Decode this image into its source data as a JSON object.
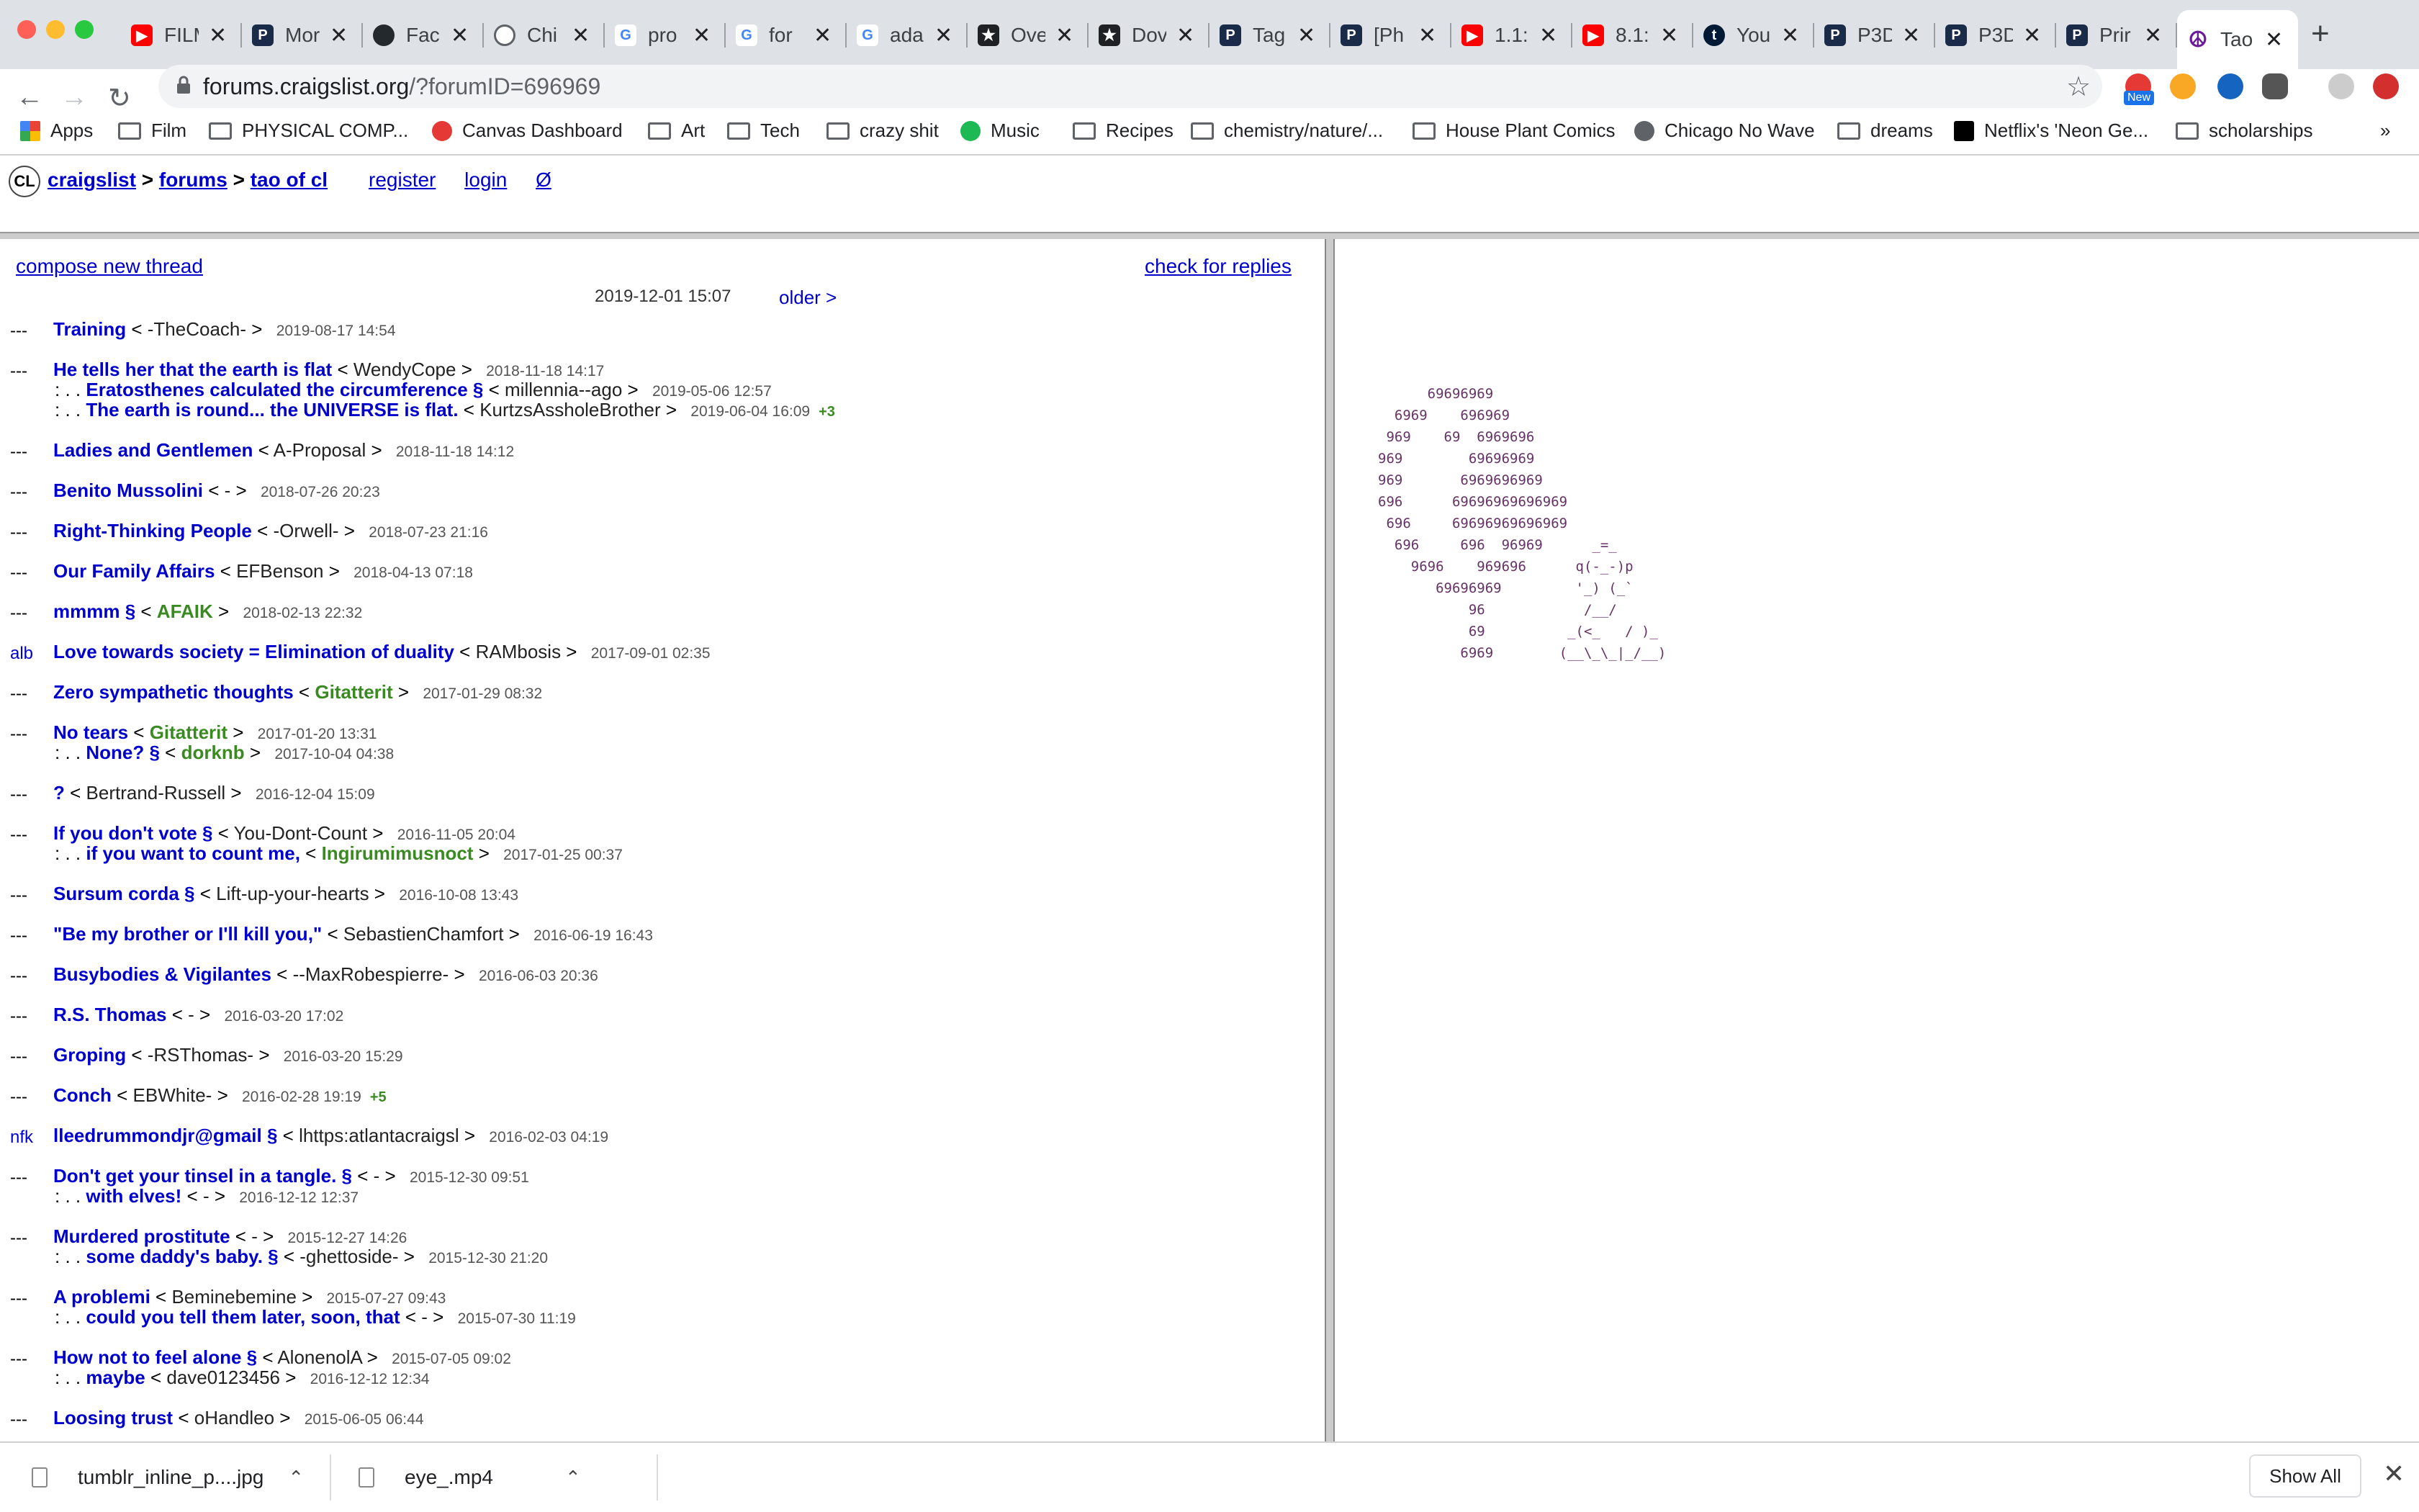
{
  "browser": {
    "tabs": [
      {
        "title": "FILM",
        "icon": "youtube-icon",
        "color": "#ff0000"
      },
      {
        "title": "Mor",
        "icon": "p-icon",
        "color": "#1a2b4a"
      },
      {
        "title": "Fac",
        "icon": "github-icon",
        "color": "#24292e"
      },
      {
        "title": "Chi",
        "icon": "globe-icon",
        "color": "#5f6368"
      },
      {
        "title": "pro",
        "icon": "google-icon",
        "color": "#4285f4"
      },
      {
        "title": "for",
        "icon": "google-icon",
        "color": "#4285f4"
      },
      {
        "title": "ada",
        "icon": "google-icon",
        "color": "#4285f4"
      },
      {
        "title": "Ove",
        "icon": "star-badge-icon",
        "color": "#202124"
      },
      {
        "title": "Dov",
        "icon": "star-badge-icon",
        "color": "#202124"
      },
      {
        "title": "Tag",
        "icon": "p-icon",
        "color": "#1a2b4a"
      },
      {
        "title": "[Ph",
        "icon": "p-icon",
        "color": "#1a2b4a"
      },
      {
        "title": "1.1:",
        "icon": "youtube-icon",
        "color": "#ff0000"
      },
      {
        "title": "8.1:",
        "icon": "youtube-icon",
        "color": "#ff0000"
      },
      {
        "title": "You",
        "icon": "tumblr-icon",
        "color": "#001935"
      },
      {
        "title": "P3D",
        "icon": "p-icon",
        "color": "#1a2b4a"
      },
      {
        "title": "P3D",
        "icon": "p-icon",
        "color": "#1a2b4a"
      },
      {
        "title": "Prir",
        "icon": "p-icon",
        "color": "#1a2b4a"
      },
      {
        "title": "Tao",
        "icon": "peace-icon",
        "color": "#6a1b9a",
        "active": true
      }
    ],
    "url_host": "forums.craigslist.org",
    "url_path": "/?forumID=696969",
    "extension_badge": "New",
    "bookmarks": [
      {
        "label": "Apps",
        "icon": "apps-grid-icon"
      },
      {
        "label": "Film",
        "icon": "folder-icon"
      },
      {
        "label": "PHYSICAL COMP...",
        "icon": "folder-icon"
      },
      {
        "label": "Canvas Dashboard",
        "icon": "canvas-icon"
      },
      {
        "label": "Art",
        "icon": "folder-icon"
      },
      {
        "label": "Tech",
        "icon": "folder-icon"
      },
      {
        "label": "crazy shit",
        "icon": "folder-icon"
      },
      {
        "label": "Music",
        "icon": "spotify-icon"
      },
      {
        "label": "Recipes",
        "icon": "folder-icon"
      },
      {
        "label": "chemistry/nature/...",
        "icon": "folder-icon"
      },
      {
        "label": "House Plant Comics",
        "icon": "folder-icon"
      },
      {
        "label": "Chicago No Wave",
        "icon": "globe-icon"
      },
      {
        "label": "dreams",
        "icon": "folder-icon"
      },
      {
        "label": "Netflix's 'Neon Ge...",
        "icon": "netflix-icon"
      },
      {
        "label": "scholarships",
        "icon": "folder-icon"
      }
    ],
    "more_bookmarks": "»"
  },
  "header": {
    "logo": "CL",
    "breadcrumb": [
      "craigslist",
      "forums",
      "tao of cl"
    ],
    "sep": ">",
    "links": [
      "register",
      "login",
      "Ø"
    ]
  },
  "forum": {
    "compose": "compose new thread",
    "check": "check for replies",
    "current_date": "2019-12-01 15:07",
    "older": "older >",
    "threads": [
      {
        "mark": "---",
        "posts": [
          {
            "subject": "Training",
            "author": "-TheCoach-",
            "date": "2019-08-17 14:54"
          }
        ]
      },
      {
        "mark": "---",
        "posts": [
          {
            "subject": "He tells her that the earth is flat",
            "author": "WendyCope",
            "date": "2018-11-18 14:17"
          },
          {
            "subject": "Eratosthenes calculated the circumference §",
            "author": "millennia--ago",
            "date": "2019-05-06 12:57",
            "indent": ": . ."
          },
          {
            "subject": "The earth is round... the UNIVERSE is flat.",
            "author": "KurtzsAssholeBrother",
            "date": "2019-06-04 16:09",
            "indent": ": . .",
            "more": "+3"
          }
        ]
      },
      {
        "mark": "---",
        "posts": [
          {
            "subject": "Ladies and Gentlemen",
            "author": "A-Proposal",
            "date": "2018-11-18 14:12"
          }
        ]
      },
      {
        "mark": "---",
        "posts": [
          {
            "subject": "Benito Mussolini",
            "author": "-",
            "date": "2018-07-26 20:23"
          }
        ]
      },
      {
        "mark": "---",
        "posts": [
          {
            "subject": "Right-Thinking People",
            "author": "-Orwell-",
            "date": "2018-07-23 21:16"
          }
        ]
      },
      {
        "mark": "---",
        "posts": [
          {
            "subject": "Our Family Affairs",
            "author": "EFBenson",
            "date": "2018-04-13 07:18"
          }
        ]
      },
      {
        "mark": "---",
        "posts": [
          {
            "subject": "mmmm §",
            "author": "AFAIK",
            "author_green": true,
            "date": "2018-02-13 22:32"
          }
        ]
      },
      {
        "mark": "alb",
        "mark_tag": true,
        "posts": [
          {
            "subject": "Love towards society = Elimination of duality",
            "author": "RAMbosis",
            "date": "2017-09-01 02:35"
          }
        ]
      },
      {
        "mark": "---",
        "posts": [
          {
            "subject": "Zero sympathetic thoughts",
            "author": "Gitatterit",
            "author_green": true,
            "date": "2017-01-29 08:32"
          }
        ]
      },
      {
        "mark": "---",
        "posts": [
          {
            "subject": "No tears",
            "author": "Gitatterit",
            "author_green": true,
            "date": "2017-01-20 13:31"
          },
          {
            "subject": "None? §",
            "author": "dorknb",
            "author_green": true,
            "date": "2017-10-04 04:38",
            "indent": ": . ."
          }
        ]
      },
      {
        "mark": "---",
        "posts": [
          {
            "subject": "?",
            "author": "Bertrand-Russell",
            "date": "2016-12-04 15:09"
          }
        ]
      },
      {
        "mark": "---",
        "posts": [
          {
            "subject": "If you don't vote §",
            "author": "You-Dont-Count",
            "date": "2016-11-05 20:04"
          },
          {
            "subject": "if you want to count me,",
            "author": "Ingirumimusnoct",
            "author_green": true,
            "date": "2017-01-25 00:37",
            "indent": ": . ."
          }
        ]
      },
      {
        "mark": "---",
        "posts": [
          {
            "subject": "Sursum corda §",
            "author": "Lift-up-your-hearts",
            "date": "2016-10-08 13:43"
          }
        ]
      },
      {
        "mark": "---",
        "posts": [
          {
            "subject": "\"Be my brother or I'll kill you,\"",
            "author": "SebastienChamfort",
            "date": "2016-06-19 16:43"
          }
        ]
      },
      {
        "mark": "---",
        "posts": [
          {
            "subject": "Busybodies & Vigilantes",
            "author": "--MaxRobespierre-",
            "date": "2016-06-03 20:36"
          }
        ]
      },
      {
        "mark": "---",
        "posts": [
          {
            "subject": "R.S. Thomas",
            "author": "-",
            "date": "2016-03-20 17:02"
          }
        ]
      },
      {
        "mark": "---",
        "posts": [
          {
            "subject": "Groping",
            "author": "-RSThomas-",
            "date": "2016-03-20 15:29"
          }
        ]
      },
      {
        "mark": "---",
        "posts": [
          {
            "subject": "Conch",
            "author": "EBWhite-",
            "date": "2016-02-28 19:19",
            "more": "+5"
          }
        ]
      },
      {
        "mark": "nfk",
        "mark_tag": true,
        "posts": [
          {
            "subject": "lleedrummondjr@gmail §",
            "author": "lhttps:atlantacraigsl",
            "date": "2016-02-03 04:19"
          }
        ]
      },
      {
        "mark": "---",
        "posts": [
          {
            "subject": "Don't get your tinsel in a tangle. §",
            "author": "-",
            "date": "2015-12-30 09:51"
          },
          {
            "subject": "with elves!",
            "author": "-",
            "date": "2016-12-12 12:37",
            "indent": ": . ."
          }
        ]
      },
      {
        "mark": "---",
        "posts": [
          {
            "subject": "Murdered prostitute",
            "author": "-",
            "date": "2015-12-27 14:26"
          },
          {
            "subject": "some daddy's baby. §",
            "author": "-ghettoside-",
            "date": "2015-12-30 21:20",
            "indent": ": . ."
          }
        ]
      },
      {
        "mark": "---",
        "posts": [
          {
            "subject": "A problemi",
            "author": "Beminebemine",
            "date": "2015-07-27 09:43"
          },
          {
            "subject": "could you tell them later, soon, that",
            "author": "-",
            "date": "2015-07-30 11:19",
            "indent": ": . ."
          }
        ]
      },
      {
        "mark": "---",
        "posts": [
          {
            "subject": "How not to feel alone §",
            "author": "AlonenolA",
            "date": "2015-07-05 09:02"
          },
          {
            "subject": "maybe",
            "author": "dave0123456",
            "date": "2016-12-12 12:34",
            "indent": ": . ."
          }
        ]
      },
      {
        "mark": "---",
        "posts": [
          {
            "subject": "Loosing trust",
            "author": "oHandleo",
            "date": "2015-06-05 06:44"
          }
        ]
      }
    ]
  },
  "ascii_art": "      69696969\n  6969    696969\n 969    69  6969696\n969        69696969\n969       6969696969\n696      69696969696969\n 696     69696969696969\n  696     696  96969      _=_\n    9696    969696      q(-_-)p\n       69696969         '_) (_`\n           96            /__/\n           69          _(<_   / )_\n          6969        (__\\_\\_|_/__)",
  "downloads": {
    "items": [
      {
        "name": "tumblr_inline_p....jpg"
      },
      {
        "name": "eye_.mp4"
      }
    ],
    "show_all": "Show All"
  }
}
